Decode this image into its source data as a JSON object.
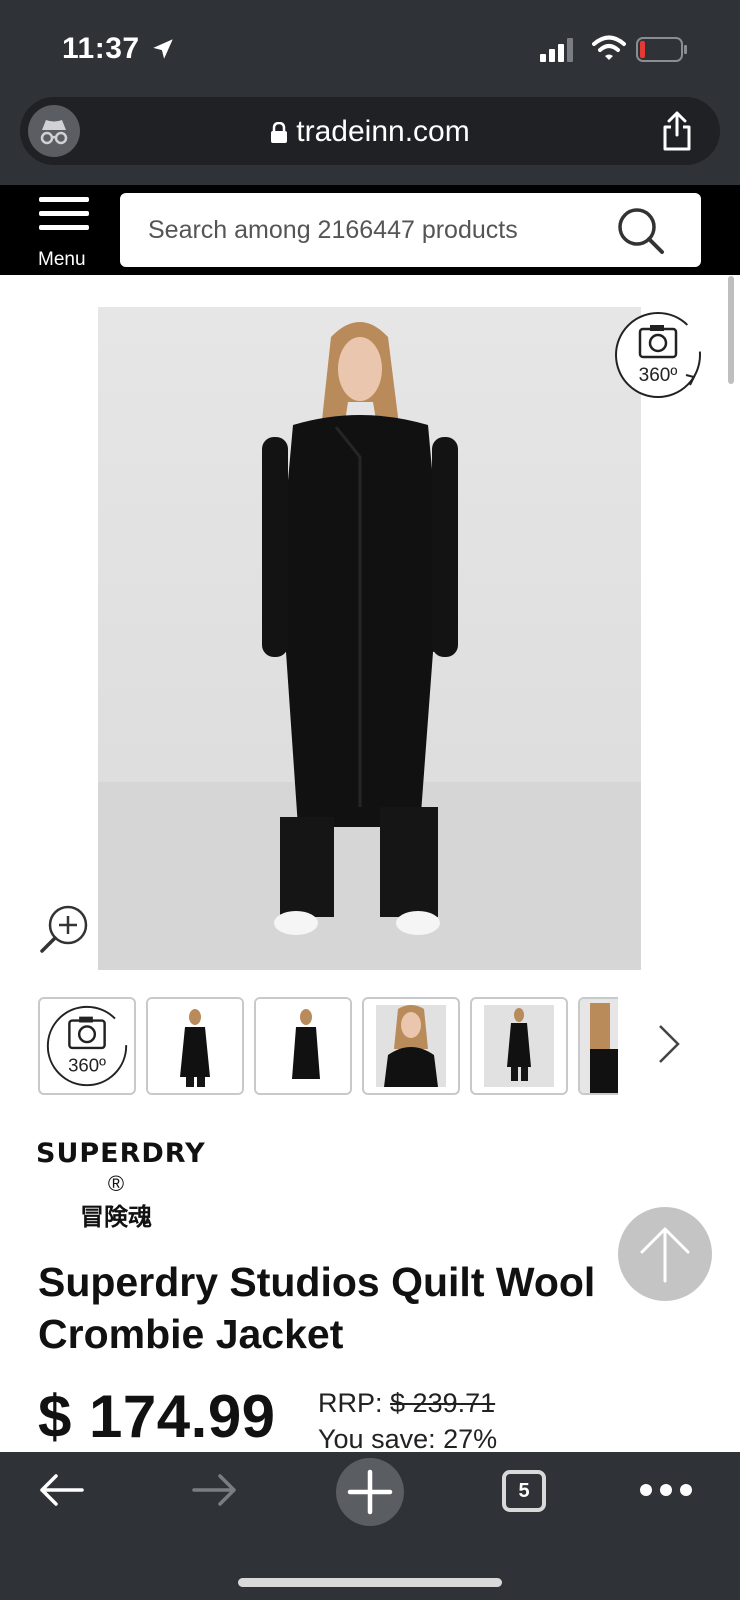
{
  "status_bar": {
    "time": "11:37",
    "battery_color": "#e53935"
  },
  "browser": {
    "url": "tradeinn.com",
    "open_tabs": "5"
  },
  "site_header": {
    "menu_label": "Menu",
    "search_placeholder": "Search among 2166447 products"
  },
  "gallery": {
    "spin_label": "360º",
    "thumbnails": [
      "360º",
      "front view",
      "back view",
      "detail view",
      "full look",
      "close-up"
    ]
  },
  "brand": {
    "name": "SUPERDRY",
    "registered": "®",
    "tagline": "冒険魂"
  },
  "product": {
    "title": "Superdry Studios Quilt Wool Crombie Jacket",
    "price": "$ 174.99",
    "rrp_label": "RRP:",
    "rrp_value": "$ 239.71",
    "you_save": "You save: 27%"
  }
}
